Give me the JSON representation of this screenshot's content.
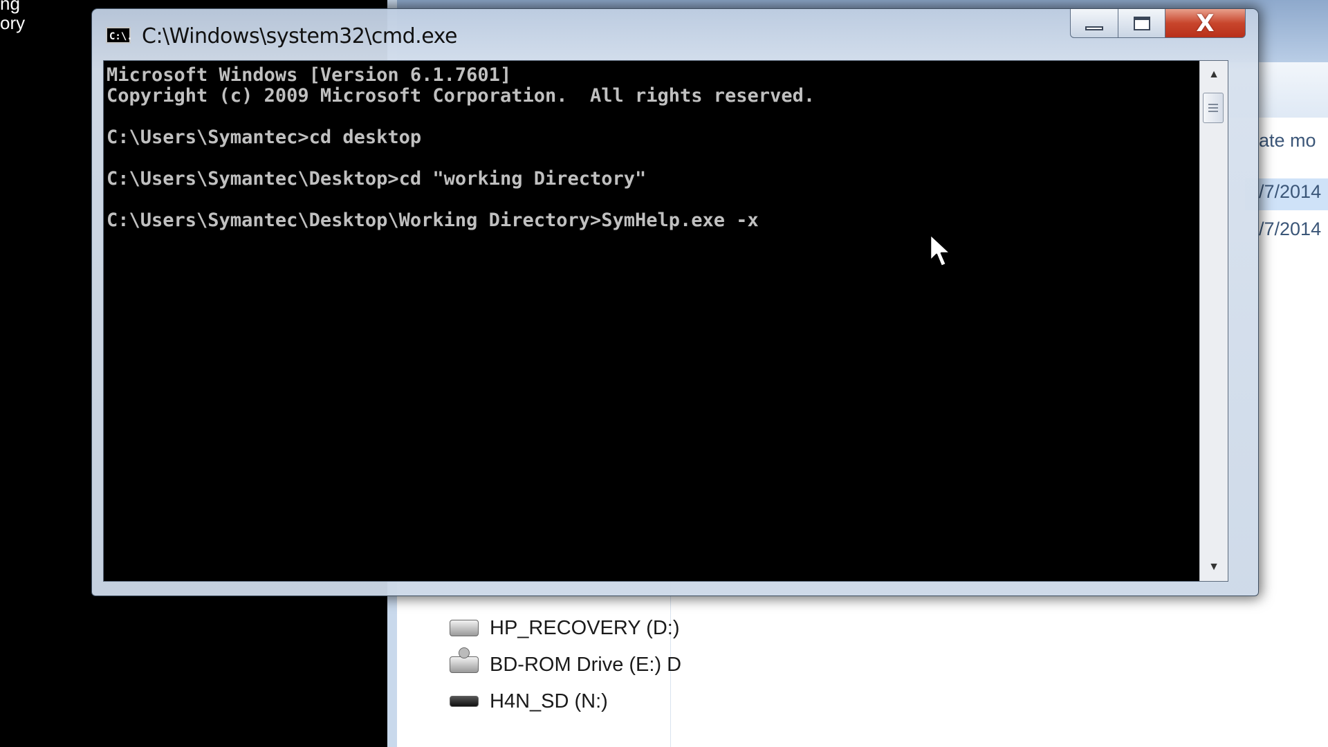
{
  "desktop": {
    "label_fragments": [
      "ng",
      "ory"
    ]
  },
  "cmd_window": {
    "title": "C:\\Windows\\system32\\cmd.exe",
    "icon_text": "C:\\.",
    "console_lines": [
      "Microsoft Windows [Version 6.1.7601]",
      "Copyright (c) 2009 Microsoft Corporation.  All rights reserved.",
      "",
      "C:\\Users\\Symantec>cd desktop",
      "",
      "C:\\Users\\Symantec\\Desktop>cd \"working Directory\"",
      "",
      "C:\\Users\\Symantec\\Desktop\\Working Directory>SymHelp.exe -x"
    ],
    "close_glyph": "X"
  },
  "explorer": {
    "column_header": "ate mo",
    "dates": [
      "/7/2014",
      "/7/2014"
    ],
    "drives": [
      {
        "label": "HP_RECOVERY (D:)",
        "icon": "hard-drive-icon"
      },
      {
        "label": "BD-ROM Drive (E:) D",
        "icon": "optical-drive-icon"
      },
      {
        "label": "H4N_SD (N:)",
        "icon": "removable-drive-icon"
      }
    ]
  },
  "colors": {
    "console_bg": "#000000",
    "console_fg": "#c0c0c0",
    "close_button": "#c8452c",
    "frame": "#c8d6e8"
  }
}
